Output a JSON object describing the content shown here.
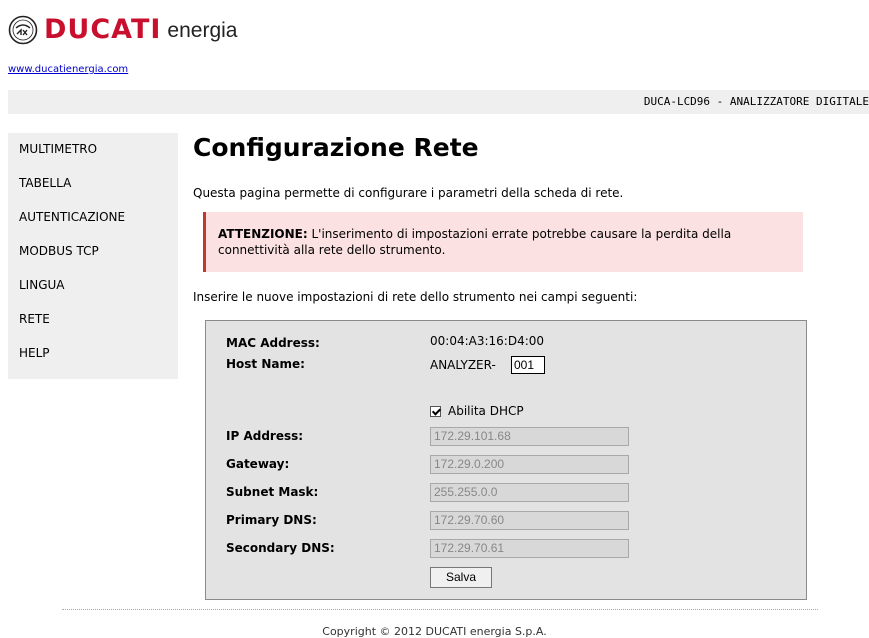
{
  "header": {
    "brand_name": "DUCATI",
    "brand_suffix": "energia",
    "site_link": "www.ducatienergia.com",
    "device_title": "DUCA-LCD96 - ANALIZZATORE DIGITALE"
  },
  "sidebar": {
    "items": [
      {
        "label": "MULTIMETRO"
      },
      {
        "label": "TABELLA"
      },
      {
        "label": "AUTENTICAZIONE"
      },
      {
        "label": "MODBUS TCP"
      },
      {
        "label": "LINGUA"
      },
      {
        "label": "RETE"
      },
      {
        "label": "HELP"
      }
    ]
  },
  "main": {
    "title": "Configurazione Rete",
    "intro": "Questa pagina permette di configurare i parametri della scheda di rete.",
    "warning_label": "ATTENZIONE:",
    "warning_text": " L'inserimento di impostazioni errate potrebbe causare la perdita della connettività alla rete dello strumento.",
    "instructions": "Inserire le nuove impostazioni di rete dello strumento nei campi seguenti:"
  },
  "form": {
    "mac_label": "MAC Address:",
    "mac_value": "00:04:A3:16:D4:00",
    "host_label": "Host Name:",
    "host_prefix": "ANALYZER-",
    "host_value": "001",
    "dhcp_label": "Abilita DHCP",
    "dhcp_checked": true,
    "ip_label": "IP Address:",
    "ip_value": "172.29.101.68",
    "gateway_label": "Gateway:",
    "gateway_value": "172.29.0.200",
    "subnet_label": "Subnet Mask:",
    "subnet_value": "255.255.0.0",
    "dns1_label": "Primary DNS:",
    "dns1_value": "172.29.70.60",
    "dns2_label": "Secondary DNS:",
    "dns2_value": "172.29.70.61",
    "save_label": "Salva"
  },
  "footer": {
    "copyright": "Copyright © 2012 DUCATI energia S.p.A."
  },
  "colors": {
    "brand_red": "#c8102e",
    "sidebar_bg": "#efefef",
    "warning_bg": "#fbe1e1",
    "warning_border": "#c0392b",
    "form_bg": "#e3e3e3",
    "link": "#0000cc"
  }
}
